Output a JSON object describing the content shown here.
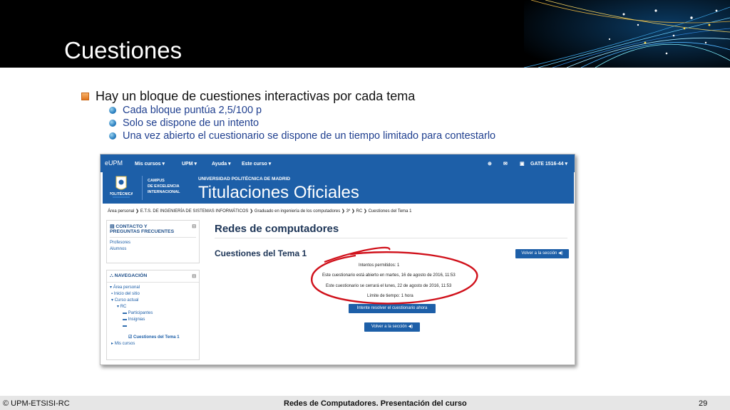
{
  "slide": {
    "title": "Cuestiones",
    "main_bullet": "Hay un bloque de cuestiones interactivas por cada tema",
    "sub_bullets": [
      "Cada bloque puntúa 2,5/100 p",
      "Solo se dispone de un intento",
      "Una vez abierto el cuestionario se dispone de un tiempo limitado para contestarlo"
    ]
  },
  "footer": {
    "left": "© UPM-ETSISI-RC",
    "center": "Redes de Computadores. Presentación del curso",
    "page": "29"
  },
  "moodle": {
    "brand": "eUPM",
    "nav": [
      "Mis cursos ▾",
      "UPM ▾",
      "Ayuda ▾",
      "Este curso ▾"
    ],
    "user": "GATE 1516-44 ▾",
    "banner": {
      "logo_text": "POLITÉCNICA",
      "campus": [
        "CAMPUS",
        "DE EXCELENCIA",
        "INTERNACIONAL"
      ],
      "university": "UNIVERSIDAD POLITÉCNICA DE MADRID",
      "title": "Titulaciones Oficiales"
    },
    "breadcrumb": [
      "Área personal",
      "E.T.S. DE INGENIERÍA DE SISTEMAS INFORMÁTICOS",
      "Graduado en ingeniería de los computadores",
      "3º",
      "RC",
      "Cuestiones del Tema 1"
    ],
    "contact_block": {
      "title_line1": "CONTACTO Y",
      "title_line2": "PREGUNTAS FRECUENTES",
      "links": [
        "Profesores",
        "Alumnos"
      ]
    },
    "nav_block": {
      "title": "NAVEGACIÓN",
      "items": [
        "Área personal",
        "Inicio del sitio",
        "Curso actual",
        "RC",
        "Participantes",
        "Insignias",
        "",
        "Cuestiones del Tema 1",
        "Mis cursos"
      ]
    },
    "page_title": "Redes de computadores",
    "section_title": "Cuestiones del Tema 1",
    "back_button": "Volver a la sección ◀)",
    "info_lines": [
      "Intentos permitidos: 1",
      "Este cuestionario está abierto en martes, 16 de agosto de 2016, 11:53",
      "Este cuestionario se cerrará el lunes, 22 de agosto de 2016, 11:53",
      "Límite de tiempo: 1 hora"
    ],
    "attempt_button": "Intente resolver el cuestionario ahora",
    "back_button_2": "Volver a la sección ◀)"
  },
  "colors": {
    "moodle_blue": "#1d5fa8",
    "annotation_red": "#d0101a",
    "bullet_orange": "#e0751e"
  }
}
